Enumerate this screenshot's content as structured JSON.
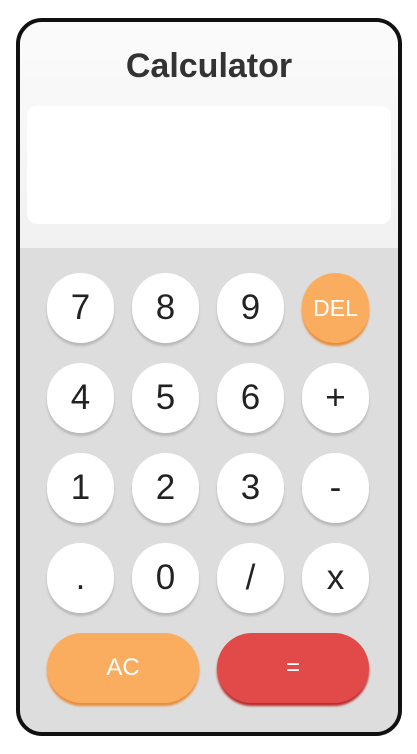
{
  "app": {
    "title": "Calculator",
    "display_value": ""
  },
  "keys": {
    "seven": "7",
    "eight": "8",
    "nine": "9",
    "delete": "DEL",
    "four": "4",
    "five": "5",
    "six": "6",
    "plus": "+",
    "one": "1",
    "two": "2",
    "three": "3",
    "minus": "-",
    "dot": ".",
    "zero": "0",
    "divide": "/",
    "multiply": "x",
    "clear": "AC",
    "equals": "="
  },
  "colors": {
    "accent_orange": "#fbad5f",
    "equals_red": "#e24a4a",
    "keypad_bg": "#dddddd"
  }
}
